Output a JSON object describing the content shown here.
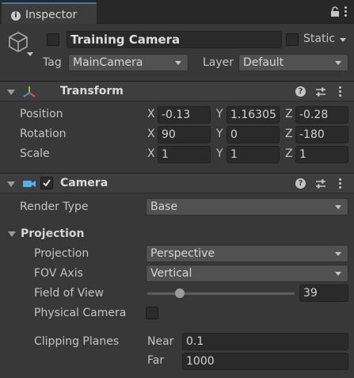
{
  "tab": {
    "title": "Inspector"
  },
  "header": {
    "object_name": "Training Camera",
    "static_label": "Static",
    "tag_label": "Tag",
    "tag_value": "MainCamera",
    "layer_label": "Layer",
    "layer_value": "Default"
  },
  "transform": {
    "title": "Transform",
    "rows": [
      {
        "label": "Position",
        "x": "-0.13",
        "y": "1.16305",
        "z": "-0.28"
      },
      {
        "label": "Rotation",
        "x": "90",
        "y": "0",
        "z": "-180"
      },
      {
        "label": "Scale",
        "x": "1",
        "y": "1",
        "z": "1"
      }
    ],
    "axis_x": "X",
    "axis_y": "Y",
    "axis_z": "Z"
  },
  "camera": {
    "title": "Camera",
    "render_type_label": "Render Type",
    "render_type_value": "Base",
    "projection_section": "Projection",
    "projection_label": "Projection",
    "projection_value": "Perspective",
    "fov_axis_label": "FOV Axis",
    "fov_axis_value": "Vertical",
    "fov_label": "Field of View",
    "fov_value": "39",
    "fov_fraction": 0.22,
    "physical_camera_label": "Physical Camera",
    "clipping_label": "Clipping Planes",
    "near_label": "Near",
    "near_value": "0.1",
    "far_label": "Far",
    "far_value": "1000"
  },
  "colors": {
    "accent": "#3a79bb",
    "camera_icon": "#4fb3ea"
  }
}
